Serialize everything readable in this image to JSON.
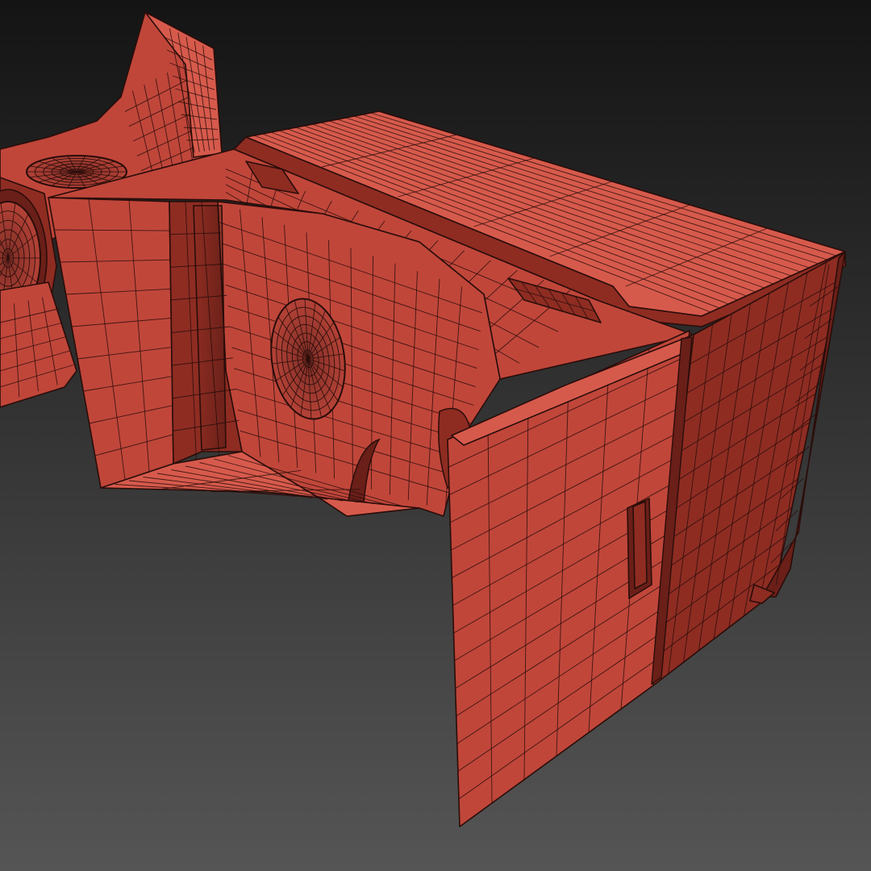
{
  "viewport": {
    "background_top": "#141414",
    "background_bottom": "#555555"
  },
  "model": {
    "shaded_color": "#c0463a",
    "shaded_light": "#d65a4c",
    "shaded_dark": "#8e2c22",
    "shaded_darkest": "#6a1f18",
    "wire_color": "#2a0d0a",
    "display_mode": "shaded-wireframe"
  }
}
